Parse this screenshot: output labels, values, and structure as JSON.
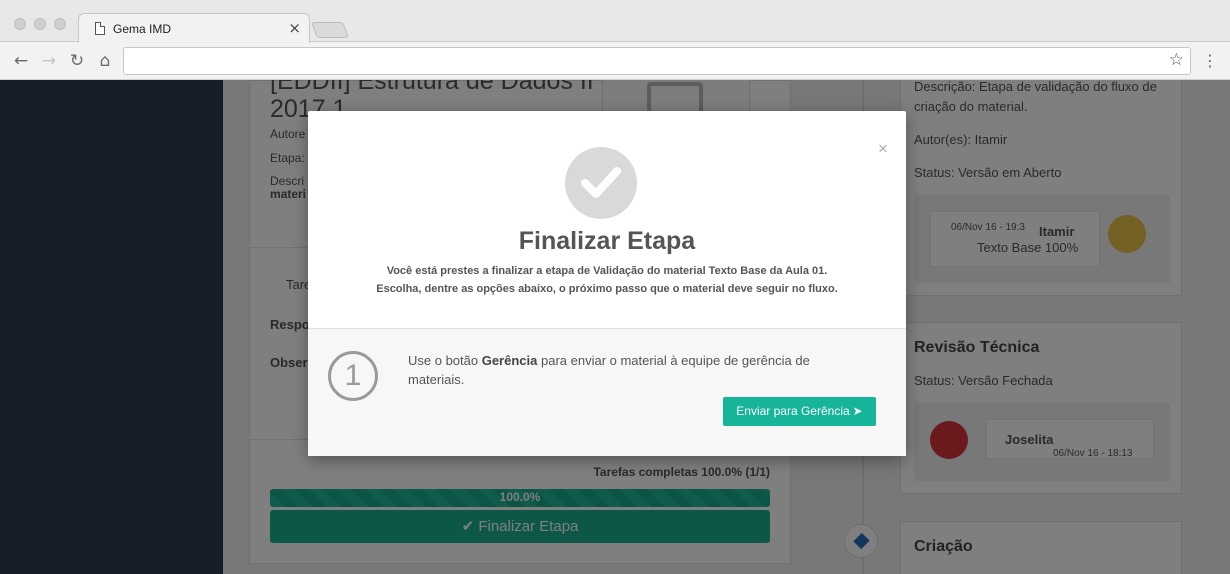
{
  "browser": {
    "tab_title": "Gema IMD",
    "tab_close": "×",
    "address": ""
  },
  "page": {
    "title_line1": "[EDDII] Estrutura de Dados II -",
    "title_line2": "2017.1",
    "authors_label": "Autore",
    "stage_label": "Etapa:",
    "description_label": "Descri",
    "description_bold": "materi",
    "tasks_label": "Tare",
    "responsible_label": "Respo",
    "observation_label": "Obser",
    "tasks_completed": "Tarefas completas 100.0% (1/1)",
    "progress_value": "100.0%",
    "progress_fraction": 1.0,
    "finalize_button": "Finalizar Etapa"
  },
  "right_panel": {
    "card1": {
      "description": "Descrição: Etapa de validação do fluxo de criação do material.",
      "authors": "Autor(es): Itamir",
      "status": "Status: Versão em Aberto",
      "comment": {
        "date": "06/Nov 16 - 19:3",
        "author": "Itamir",
        "text": "Texto Base 100%"
      }
    },
    "card2": {
      "heading": "Revisão Técnica",
      "status": "Status: Versão Fechada",
      "comment": {
        "author": "Joselita",
        "date": "06/Nov 16 - 18:13"
      }
    },
    "card3": {
      "heading": "Criação"
    }
  },
  "modal": {
    "close": "×",
    "title": "Finalizar Etapa",
    "description_line1": "Você está prestes a finalizar a etapa de Validação do material Texto Base da Aula 01.",
    "description_line2": "Escolha, dentre as opções abaixo, o próximo passo que o material deve seguir no fluxo.",
    "step_number": "1",
    "step_text_before": "Use o botão ",
    "step_text_bold": "Gerência",
    "step_text_after": " para enviar o material à equipe de gerência de materiais.",
    "send_button": "Enviar para Gerência"
  },
  "colors": {
    "accent": "#16b59a",
    "sidebar": "#2e3d4f",
    "overlay": "rgba(0,0,0,0.5)"
  },
  "icons": [
    "file-icon",
    "back-icon",
    "forward-icon",
    "reload-icon",
    "home-icon",
    "star-icon",
    "menu-icon",
    "check-icon",
    "close-icon",
    "paper-plane-icon"
  ]
}
